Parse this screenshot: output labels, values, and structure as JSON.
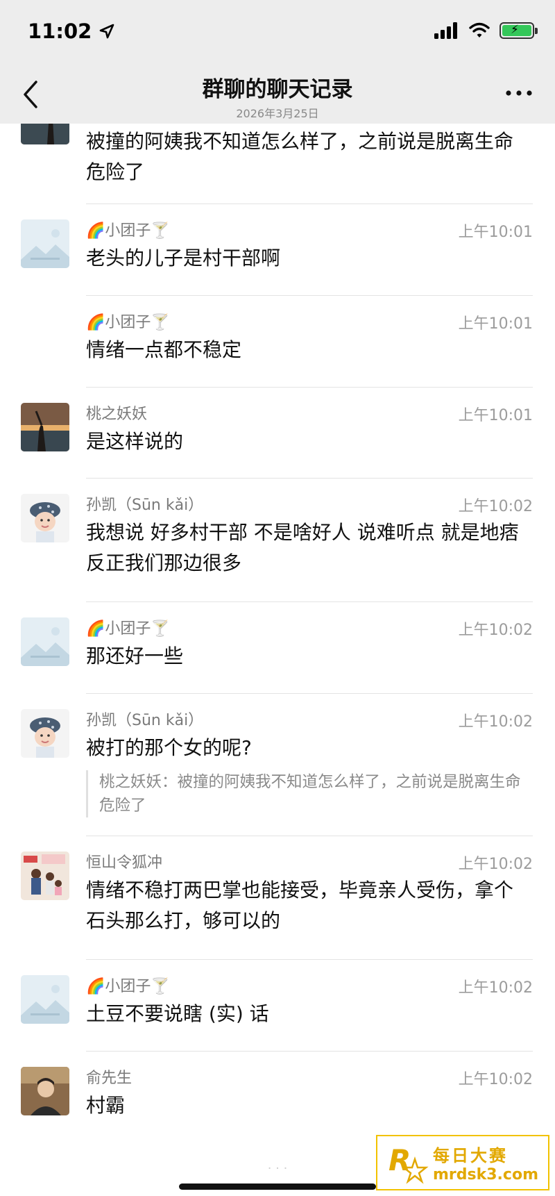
{
  "status_bar": {
    "time": "11:02"
  },
  "header": {
    "title": "群聊的聊天记录",
    "subtitle": "2026年3月25日"
  },
  "messages": [
    {
      "sender": "",
      "time": "",
      "text": "被撞的阿姨我不知道怎么样了，之前说是脱离生命危险了",
      "avatar": "sunset-photo"
    },
    {
      "sender": "🌈小团子🍸",
      "time": "上午10:01",
      "text": "老头的儿子是村干部啊",
      "avatar": "default-placeholder"
    },
    {
      "sender": "🌈小团子🍸",
      "time": "上午10:01",
      "text": "情绪一点都不稳定",
      "avatar": ""
    },
    {
      "sender": "桃之妖妖",
      "time": "上午10:01",
      "text": "是这样说的",
      "avatar": "sunset-photo"
    },
    {
      "sender": "孙凯（Sūn kǎi）",
      "time": "上午10:02",
      "text": "我想说   好多村干部  不是啥好人      说难听点 就是地痞   反正我们那边很多",
      "avatar": "child-photo"
    },
    {
      "sender": "🌈小团子🍸",
      "time": "上午10:02",
      "text": "那还好一些",
      "avatar": "default-placeholder"
    },
    {
      "sender": "孙凯（Sūn kǎi）",
      "time": "上午10:02",
      "text": "被打的那个女的呢?",
      "avatar": "child-photo",
      "quote": "桃之妖妖：被撞的阿姨我不知道怎么样了，之前说是脱离生命危险了"
    },
    {
      "sender": "恒山令狐冲",
      "time": "上午10:02",
      "text": "情绪不稳打两巴掌也能接受，毕竟亲人受伤，拿个石头那么打，够可以的",
      "avatar": "family-photo"
    },
    {
      "sender": "🌈小团子🍸",
      "time": "上午10:02",
      "text": "土豆不要说瞎 (实) 话",
      "avatar": "default-placeholder"
    },
    {
      "sender": "俞先生",
      "time": "上午10:02",
      "text": "村霸",
      "avatar": "man-photo"
    }
  ],
  "watermark": {
    "text": "每日大赛",
    "url": "mrdsk3.com",
    "logo_letter": "R"
  },
  "colors": {
    "header_bg": "#ededed",
    "divider": "#e3e3e3",
    "battery": "#34c759",
    "watermark": "#e2a800"
  }
}
